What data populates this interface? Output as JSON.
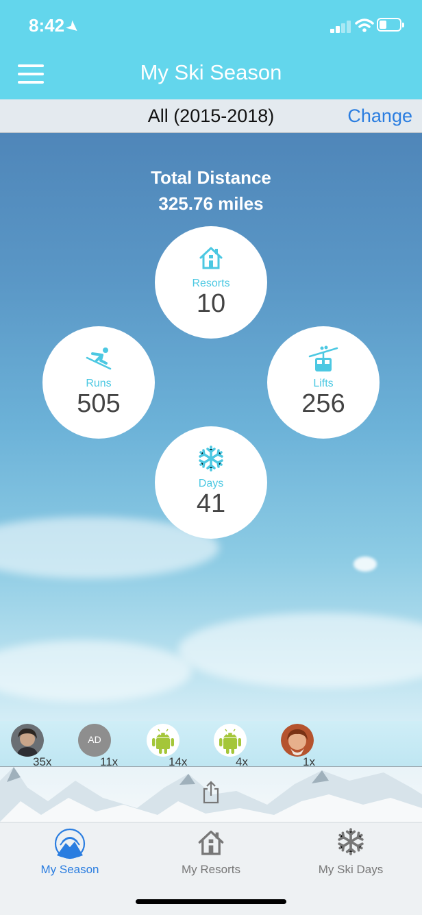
{
  "status_bar": {
    "time": "8:42"
  },
  "header": {
    "title": "My Ski Season",
    "menu_icon": "hamburger-menu-icon"
  },
  "season": {
    "label": "All (2015-2018)",
    "change_label": "Change"
  },
  "summary": {
    "title": "Total Distance",
    "value": "325.76 miles"
  },
  "stats": {
    "resorts": {
      "label": "Resorts",
      "value": "10",
      "icon": "house-icon"
    },
    "runs": {
      "label": "Runs",
      "value": "505",
      "icon": "skier-icon"
    },
    "lifts": {
      "label": "Lifts",
      "value": "256",
      "icon": "gondola-icon"
    },
    "days": {
      "label": "Days",
      "value": "41",
      "icon": "snowflake-icon"
    }
  },
  "friends": [
    {
      "count": "35x",
      "avatar": "photo"
    },
    {
      "count": "11x",
      "avatar": "initials",
      "initials": "AD"
    },
    {
      "count": "14x",
      "avatar": "android"
    },
    {
      "count": "4x",
      "avatar": "android"
    },
    {
      "count": "1x",
      "avatar": "photo"
    }
  ],
  "tabs": [
    {
      "label": "My Season",
      "icon": "mountain-circle-icon",
      "active": true
    },
    {
      "label": "My Resorts",
      "icon": "house-icon",
      "active": false
    },
    {
      "label": "My Ski Days",
      "icon": "snowflake-icon",
      "active": false
    }
  ],
  "colors": {
    "header": "#63d6ec",
    "accent": "#4cc8e2",
    "link": "#2a7de0",
    "android_green": "#a4c639"
  }
}
